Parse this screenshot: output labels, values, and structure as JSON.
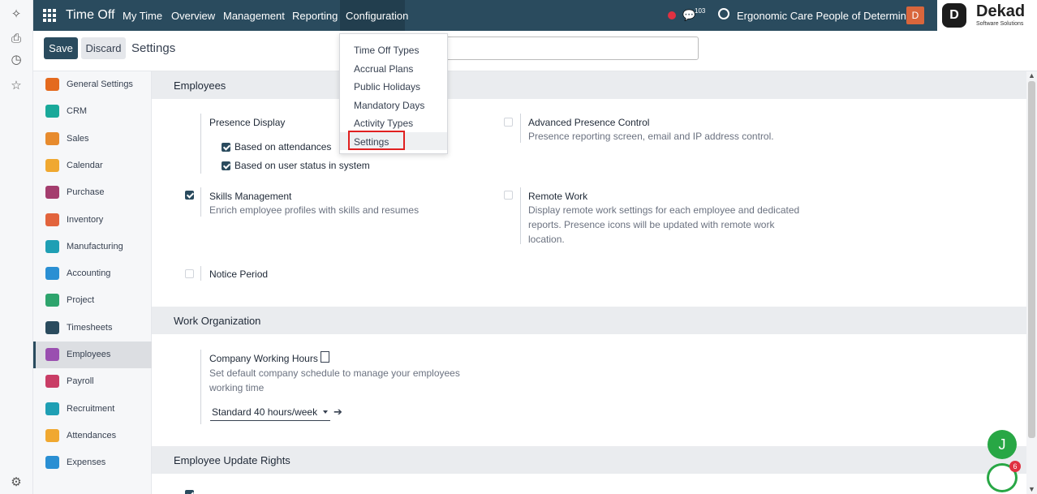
{
  "navbar": {
    "app_name": "Time Off",
    "menu": [
      "My Time",
      "Overview",
      "Management",
      "Reporting",
      "Configuration"
    ],
    "messages_count": "103",
    "company": "Ergonomic Care People of Determina...",
    "user_initial": "D"
  },
  "brand": {
    "name": "Dekad",
    "tagline": "Software Solutions",
    "mark": "D"
  },
  "control_panel": {
    "save_label": "Save",
    "discard_label": "Discard",
    "title": "Settings"
  },
  "config_menu": {
    "items": [
      "Time Off Types",
      "Accrual Plans",
      "Public Holidays",
      "Mandatory Days",
      "Activity Types",
      "Settings"
    ],
    "active": "Settings"
  },
  "sidebar": {
    "items": [
      {
        "label": "General Settings",
        "color": "#e46a1e"
      },
      {
        "label": "CRM",
        "color": "#19a99a"
      },
      {
        "label": "Sales",
        "color": "#e78b2e"
      },
      {
        "label": "Calendar",
        "color": "#f0a830"
      },
      {
        "label": "Purchase",
        "color": "#a43d6e"
      },
      {
        "label": "Inventory",
        "color": "#e2643d"
      },
      {
        "label": "Manufacturing",
        "color": "#1f9fb4"
      },
      {
        "label": "Accounting",
        "color": "#2a8fd3"
      },
      {
        "label": "Project",
        "color": "#2ea46d"
      },
      {
        "label": "Timesheets",
        "color": "#2a4b5e"
      },
      {
        "label": "Employees",
        "color": "#9a4fb0"
      },
      {
        "label": "Payroll",
        "color": "#c93d66"
      },
      {
        "label": "Recruitment",
        "color": "#1f9fb4"
      },
      {
        "label": "Attendances",
        "color": "#f0a830"
      },
      {
        "label": "Expenses",
        "color": "#2a8fd3"
      }
    ],
    "active": "Employees"
  },
  "sections": {
    "employees": {
      "title": "Employees",
      "presence": {
        "title": "Presence Display",
        "options": [
          {
            "label": "Based on attendances",
            "checked": true
          },
          {
            "label": "Based on user status in system",
            "checked": true
          }
        ]
      },
      "advanced_presence": {
        "title": "Advanced Presence Control",
        "desc": "Presence reporting screen, email and IP address control.",
        "checked": false
      },
      "skills": {
        "title": "Skills Management",
        "desc": "Enrich employee profiles with skills and resumes",
        "checked": true
      },
      "remote": {
        "title": "Remote Work",
        "desc": "Display remote work settings for each employee and dedicated reports. Presence icons will be updated with remote work location.",
        "checked": false
      },
      "notice": {
        "title": "Notice Period",
        "checked": false
      }
    },
    "work_org": {
      "title": "Work Organization",
      "hours": {
        "title": "Company Working Hours",
        "desc": "Set default company schedule to manage your employees working time",
        "value": "Standard 40 hours/week"
      }
    },
    "update_rights": {
      "title": "Employee Update Rights"
    }
  },
  "fab": {
    "initial": "J",
    "badge": "6"
  }
}
